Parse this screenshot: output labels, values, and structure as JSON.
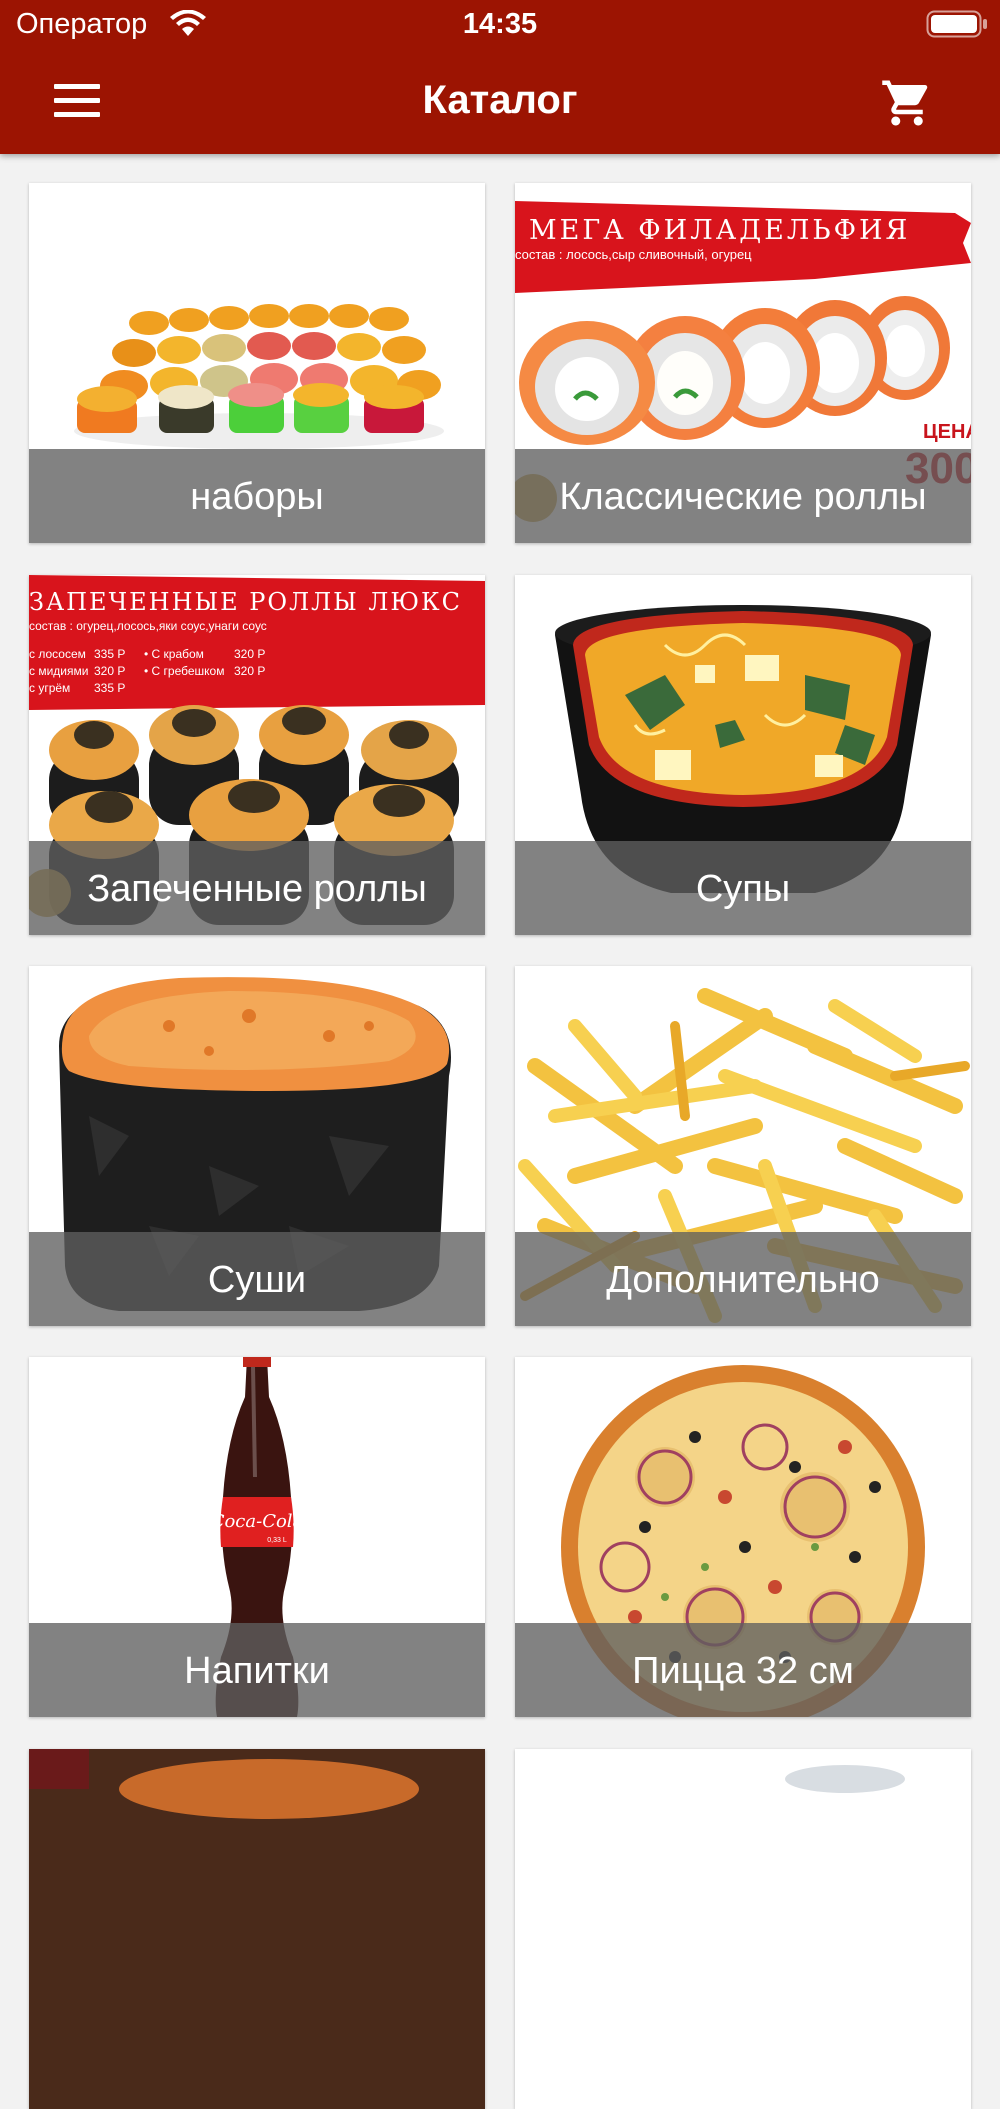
{
  "status_bar": {
    "carrier": "Оператор",
    "time": "14:35"
  },
  "navbar": {
    "title": "Каталог",
    "menu_icon": "hamburger-menu-icon",
    "cart_icon": "shopping-cart-icon"
  },
  "colors": {
    "header_bg": "#9c1402",
    "page_bg": "#f2f2f2",
    "label_overlay": "rgba(95,95,95,0.78)"
  },
  "categories": [
    {
      "label": "наборы",
      "image": "sushi-set-photo"
    },
    {
      "label": "Классические роллы",
      "image": "philadelphia-rolls-photo",
      "image_text": [
        "МЕГА ФИЛАДЕЛЬФИЯ",
        "состав : лосось,сыр сливочный, огурец",
        "ЦЕНА",
        "300"
      ]
    },
    {
      "label": "Запеченные роллы",
      "image": "baked-rolls-photo",
      "image_text": [
        "ЗАПЕЧЕННЫЕ РОЛЛЫ ЛЮКС",
        "состав : огурец,лосось,яки соус,унаги соус",
        "с лососем",
        "335 Р",
        "с мидиями",
        "320 Р",
        "с угрём",
        "335 Р",
        "• С крабом",
        "320 Р",
        "• С гребешком",
        "320 Р"
      ]
    },
    {
      "label": "Супы",
      "image": "miso-soup-photo"
    },
    {
      "label": "Суши",
      "image": "baked-gunkan-sushi-photo"
    },
    {
      "label": "Дополнительно",
      "image": "french-fries-photo"
    },
    {
      "label": "Напитки",
      "image": "coca-cola-bottle-photo",
      "image_text": [
        "Coca-Cola",
        "0,33 L"
      ]
    },
    {
      "label": "Пицца 32 см",
      "image": "pizza-photo"
    }
  ]
}
